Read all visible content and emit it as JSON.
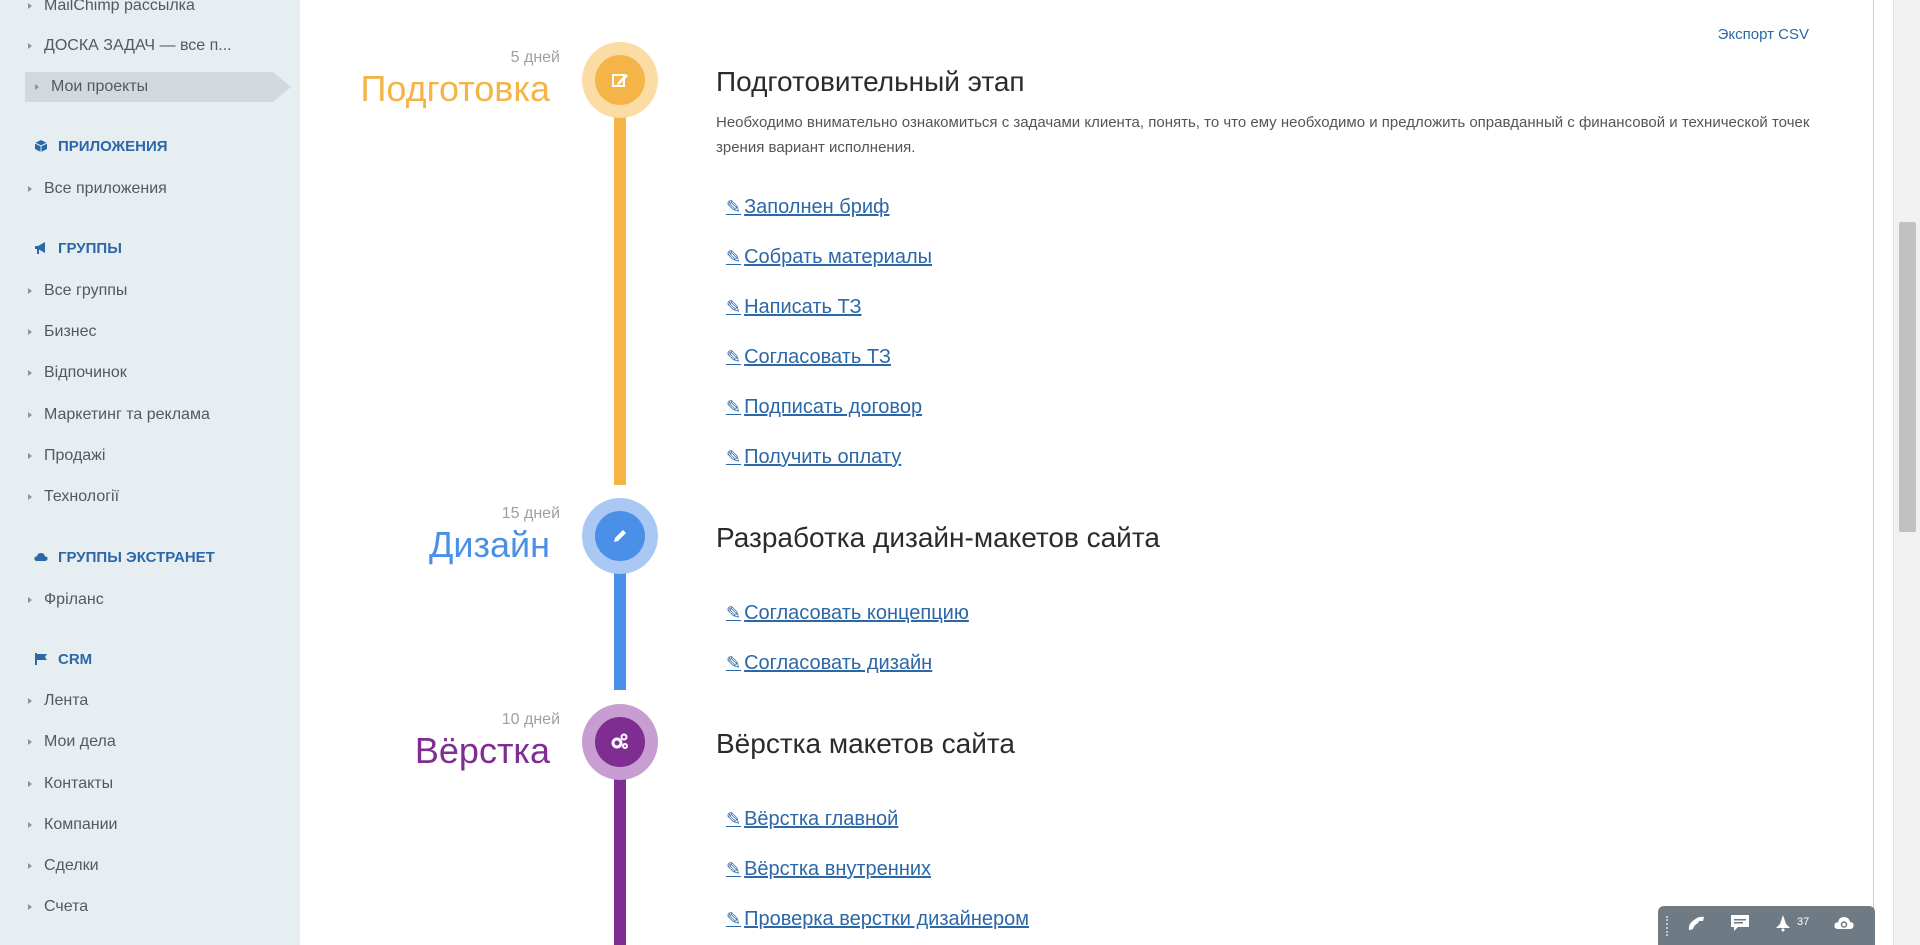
{
  "sidebar": {
    "items_top": [
      {
        "label": "MailChimp рассылка"
      },
      {
        "label": "ДОСКА ЗАДАЧ — все п..."
      },
      {
        "label": "Мои проекты"
      }
    ],
    "sections": [
      {
        "title": "ПРИЛОЖЕНИЯ",
        "icon": "cube-icon",
        "items": [
          "Все приложения"
        ]
      },
      {
        "title": "ГРУППЫ",
        "icon": "megaphone-icon",
        "items": [
          "Все группы",
          "Бизнес",
          "Відпочинок",
          "Маркетинг та реклама",
          "Продажі",
          "Технології"
        ]
      },
      {
        "title": "ГРУППЫ ЭКСТРАНЕТ",
        "icon": "cloud-icon",
        "items": [
          "Фріланс"
        ]
      },
      {
        "title": "CRM",
        "icon": "flag-icon",
        "items": [
          "Лента",
          "Мои дела",
          "Контакты",
          "Компании",
          "Сделки",
          "Счета"
        ]
      }
    ]
  },
  "main": {
    "export_label": "Экспорт CSV",
    "stages": [
      {
        "days": "5 дней",
        "name": "Подготовка",
        "color": "#f5b447",
        "ring": "#fbdca4",
        "icon": "edit-icon",
        "title": "Подготовительный этап",
        "description": "Необходимо внимательно ознакомиться с задачами клиента, понять, то что ему необходимо и предложить оправданный с финансовой и технической точек зрения вариант исполнения.",
        "tasks": [
          "Заполнен бриф",
          "Собрать материалы",
          "Написать ТЗ",
          "Согласовать ТЗ",
          "Подписать договор",
          "Получить оплату"
        ]
      },
      {
        "days": "15 дней",
        "name": "Дизайн",
        "color": "#4a8fe8",
        "ring": "#a9c8f3",
        "icon": "pencil-icon",
        "title": "Разработка дизайн-макетов сайта",
        "description": "",
        "tasks": [
          "Согласовать концепцию",
          "Согласовать дизайн"
        ]
      },
      {
        "days": "10 дней",
        "name": "Вёрстка",
        "color": "#7f2d93",
        "ring": "#c79dd2",
        "icon": "gears-icon",
        "title": "Вёрстка макетов сайта",
        "description": "",
        "tasks": [
          "Вёрстка главной",
          "Вёрстка внутренних",
          "Проверка верстки дизайнером"
        ]
      }
    ]
  },
  "bottombar": {
    "notifications_count": "37"
  }
}
